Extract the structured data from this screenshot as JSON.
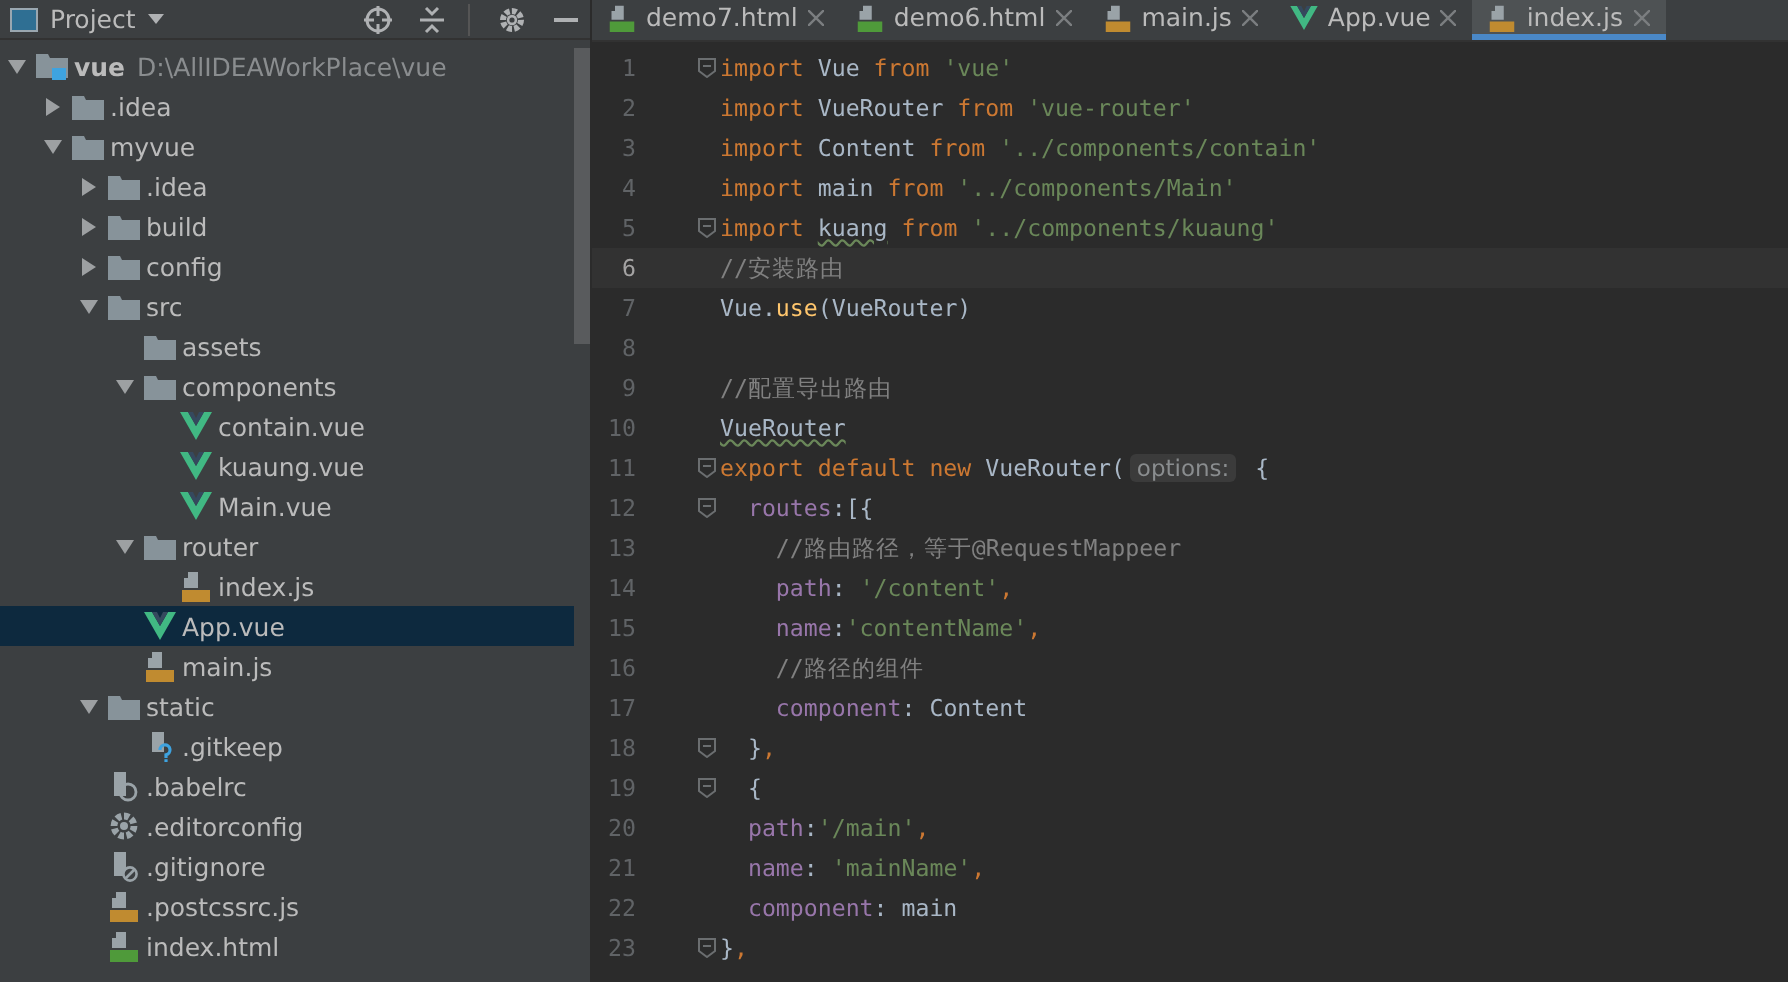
{
  "project_panel": {
    "title": "Project"
  },
  "tree": [
    {
      "name": "vue",
      "path": "D:\\AllIDEAWorkPlace\\vue",
      "kind": "module",
      "expanded": true,
      "selected": false,
      "children": [
        {
          "name": ".idea",
          "kind": "folder",
          "expanded": false,
          "selected": false
        },
        {
          "name": "myvue",
          "kind": "folder",
          "expanded": true,
          "selected": false,
          "children": [
            {
              "name": ".idea",
              "kind": "folder",
              "expanded": false,
              "selected": false
            },
            {
              "name": "build",
              "kind": "folder",
              "expanded": false,
              "selected": false
            },
            {
              "name": "config",
              "kind": "folder",
              "expanded": false,
              "selected": false
            },
            {
              "name": "src",
              "kind": "folder",
              "expanded": true,
              "selected": false,
              "children": [
                {
                  "name": "assets",
                  "kind": "leaf-folder",
                  "selected": false
                },
                {
                  "name": "components",
                  "kind": "folder",
                  "expanded": true,
                  "selected": false,
                  "children": [
                    {
                      "name": "contain.vue",
                      "kind": "vue",
                      "selected": false
                    },
                    {
                      "name": "kuaung.vue",
                      "kind": "vue",
                      "selected": false
                    },
                    {
                      "name": "Main.vue",
                      "kind": "vue",
                      "selected": false
                    }
                  ]
                },
                {
                  "name": "router",
                  "kind": "folder",
                  "expanded": true,
                  "selected": false,
                  "children": [
                    {
                      "name": "index.js",
                      "kind": "js",
                      "selected": false
                    }
                  ]
                },
                {
                  "name": "App.vue",
                  "kind": "vue",
                  "selected": true
                },
                {
                  "name": "main.js",
                  "kind": "js",
                  "selected": false
                }
              ]
            },
            {
              "name": "static",
              "kind": "folder",
              "expanded": true,
              "selected": false,
              "children": [
                {
                  "name": ".gitkeep",
                  "kind": "unknown",
                  "selected": false
                }
              ]
            },
            {
              "name": ".babelrc",
              "kind": "babel",
              "selected": false
            },
            {
              "name": ".editorconfig",
              "kind": "config",
              "selected": false
            },
            {
              "name": ".gitignore",
              "kind": "ignore",
              "selected": false
            },
            {
              "name": ".postcssrc.js",
              "kind": "js",
              "selected": false
            },
            {
              "name": "index.html",
              "kind": "html",
              "selected": false
            }
          ]
        }
      ]
    }
  ],
  "tabs": [
    {
      "label": "demo7.html",
      "kind": "html",
      "selected": false
    },
    {
      "label": "demo6.html",
      "kind": "html",
      "selected": false
    },
    {
      "label": "main.js",
      "kind": "js",
      "selected": false
    },
    {
      "label": "App.vue",
      "kind": "vue",
      "selected": false
    },
    {
      "label": "index.js",
      "kind": "js",
      "selected": true
    }
  ],
  "code_lines": [
    {
      "number": "1",
      "fold": true,
      "current": false,
      "tokens": [
        {
          "kind": "keyword",
          "text": "import"
        },
        {
          "kind": "ident",
          "text": " Vue "
        },
        {
          "kind": "keyword",
          "text": "from"
        },
        {
          "kind": "string",
          "text": " 'vue'"
        }
      ]
    },
    {
      "number": "2",
      "fold": false,
      "current": false,
      "tokens": [
        {
          "kind": "keyword",
          "text": "import"
        },
        {
          "kind": "ident",
          "text": " VueRouter "
        },
        {
          "kind": "keyword",
          "text": "from"
        },
        {
          "kind": "string",
          "text": " 'vue-router'"
        }
      ]
    },
    {
      "number": "3",
      "fold": false,
      "current": false,
      "tokens": [
        {
          "kind": "keyword",
          "text": "import"
        },
        {
          "kind": "ident",
          "text": " Content "
        },
        {
          "kind": "keyword",
          "text": "from"
        },
        {
          "kind": "string",
          "text": " '../components/contain'"
        }
      ]
    },
    {
      "number": "4",
      "fold": false,
      "current": false,
      "tokens": [
        {
          "kind": "keyword",
          "text": "import"
        },
        {
          "kind": "ident",
          "text": " main "
        },
        {
          "kind": "keyword",
          "text": "from"
        },
        {
          "kind": "string",
          "text": " '../components/Main'"
        }
      ]
    },
    {
      "number": "5",
      "fold": true,
      "current": false,
      "tokens": [
        {
          "kind": "keyword",
          "text": "import "
        },
        {
          "kind": "warn",
          "text": "kuang"
        },
        {
          "kind": "keyword",
          "text": " from"
        },
        {
          "kind": "string",
          "text": " '../components/kuaung'"
        }
      ]
    },
    {
      "number": "6",
      "fold": false,
      "current": true,
      "tokens": [
        {
          "kind": "comment",
          "text": "//安装路由"
        }
      ]
    },
    {
      "number": "7",
      "fold": false,
      "current": false,
      "tokens": [
        {
          "kind": "ident",
          "text": "Vue."
        },
        {
          "kind": "method",
          "text": "use"
        },
        {
          "kind": "ident",
          "text": "(VueRouter)"
        }
      ]
    },
    {
      "number": "8",
      "fold": false,
      "current": false
    },
    {
      "number": "9",
      "fold": false,
      "current": false,
      "tokens": [
        {
          "kind": "comment",
          "text": "//配置导出路由"
        }
      ]
    },
    {
      "number": "10",
      "fold": false,
      "current": false,
      "tokens": [
        {
          "kind": "warn",
          "text": "VueRouter"
        }
      ]
    },
    {
      "number": "11",
      "fold": true,
      "current": false,
      "tokens": [
        {
          "kind": "keyword",
          "text": "export default new"
        },
        {
          "kind": "ident",
          "text": " VueRouter("
        },
        {
          "kind": "hint",
          "text": "options:"
        },
        {
          "kind": "ident",
          "text": " {"
        }
      ]
    },
    {
      "number": "12",
      "fold": true,
      "current": false,
      "tokens": [
        {
          "kind": "prop",
          "text": "  routes"
        },
        {
          "kind": "ident",
          "text": ":[{"
        }
      ]
    },
    {
      "number": "13",
      "fold": false,
      "current": false,
      "tokens": [
        {
          "kind": "comment",
          "text": "    //路由路径，等于@RequestMappeer"
        }
      ]
    },
    {
      "number": "14",
      "fold": false,
      "current": false,
      "tokens": [
        {
          "kind": "prop",
          "text": "    path"
        },
        {
          "kind": "ident",
          "text": ": "
        },
        {
          "kind": "string",
          "text": "'/content'"
        },
        {
          "kind": "keyword",
          "text": ","
        }
      ]
    },
    {
      "number": "15",
      "fold": false,
      "current": false,
      "tokens": [
        {
          "kind": "prop",
          "text": "    name"
        },
        {
          "kind": "ident",
          "text": ":"
        },
        {
          "kind": "string",
          "text": "'contentName'"
        },
        {
          "kind": "keyword",
          "text": ","
        }
      ]
    },
    {
      "number": "16",
      "fold": false,
      "current": false,
      "tokens": [
        {
          "kind": "comment",
          "text": "    //路径的组件"
        }
      ]
    },
    {
      "number": "17",
      "fold": false,
      "current": false,
      "tokens": [
        {
          "kind": "prop",
          "text": "    component"
        },
        {
          "kind": "ident",
          "text": ": Content"
        }
      ]
    },
    {
      "number": "18",
      "fold": true,
      "current": false,
      "tokens": [
        {
          "kind": "ident",
          "text": "  }"
        },
        {
          "kind": "keyword",
          "text": ","
        }
      ]
    },
    {
      "number": "19",
      "fold": true,
      "current": false,
      "tokens": [
        {
          "kind": "ident",
          "text": "  {"
        }
      ]
    },
    {
      "number": "20",
      "fold": false,
      "current": false,
      "tokens": [
        {
          "kind": "prop",
          "text": "  path"
        },
        {
          "kind": "ident",
          "text": ":"
        },
        {
          "kind": "string",
          "text": "'/main'"
        },
        {
          "kind": "keyword",
          "text": ","
        }
      ]
    },
    {
      "number": "21",
      "fold": false,
      "current": false,
      "tokens": [
        {
          "kind": "prop",
          "text": "  name"
        },
        {
          "kind": "ident",
          "text": ": "
        },
        {
          "kind": "string",
          "text": "'mainName'"
        },
        {
          "kind": "keyword",
          "text": ","
        }
      ]
    },
    {
      "number": "22",
      "fold": false,
      "current": false,
      "tokens": [
        {
          "kind": "prop",
          "text": "  component"
        },
        {
          "kind": "ident",
          "text": ": main"
        }
      ]
    },
    {
      "number": "23",
      "fold": true,
      "current": false,
      "tokens": [
        {
          "kind": "ident",
          "text": "}"
        },
        {
          "kind": "keyword",
          "text": ","
        }
      ]
    }
  ]
}
